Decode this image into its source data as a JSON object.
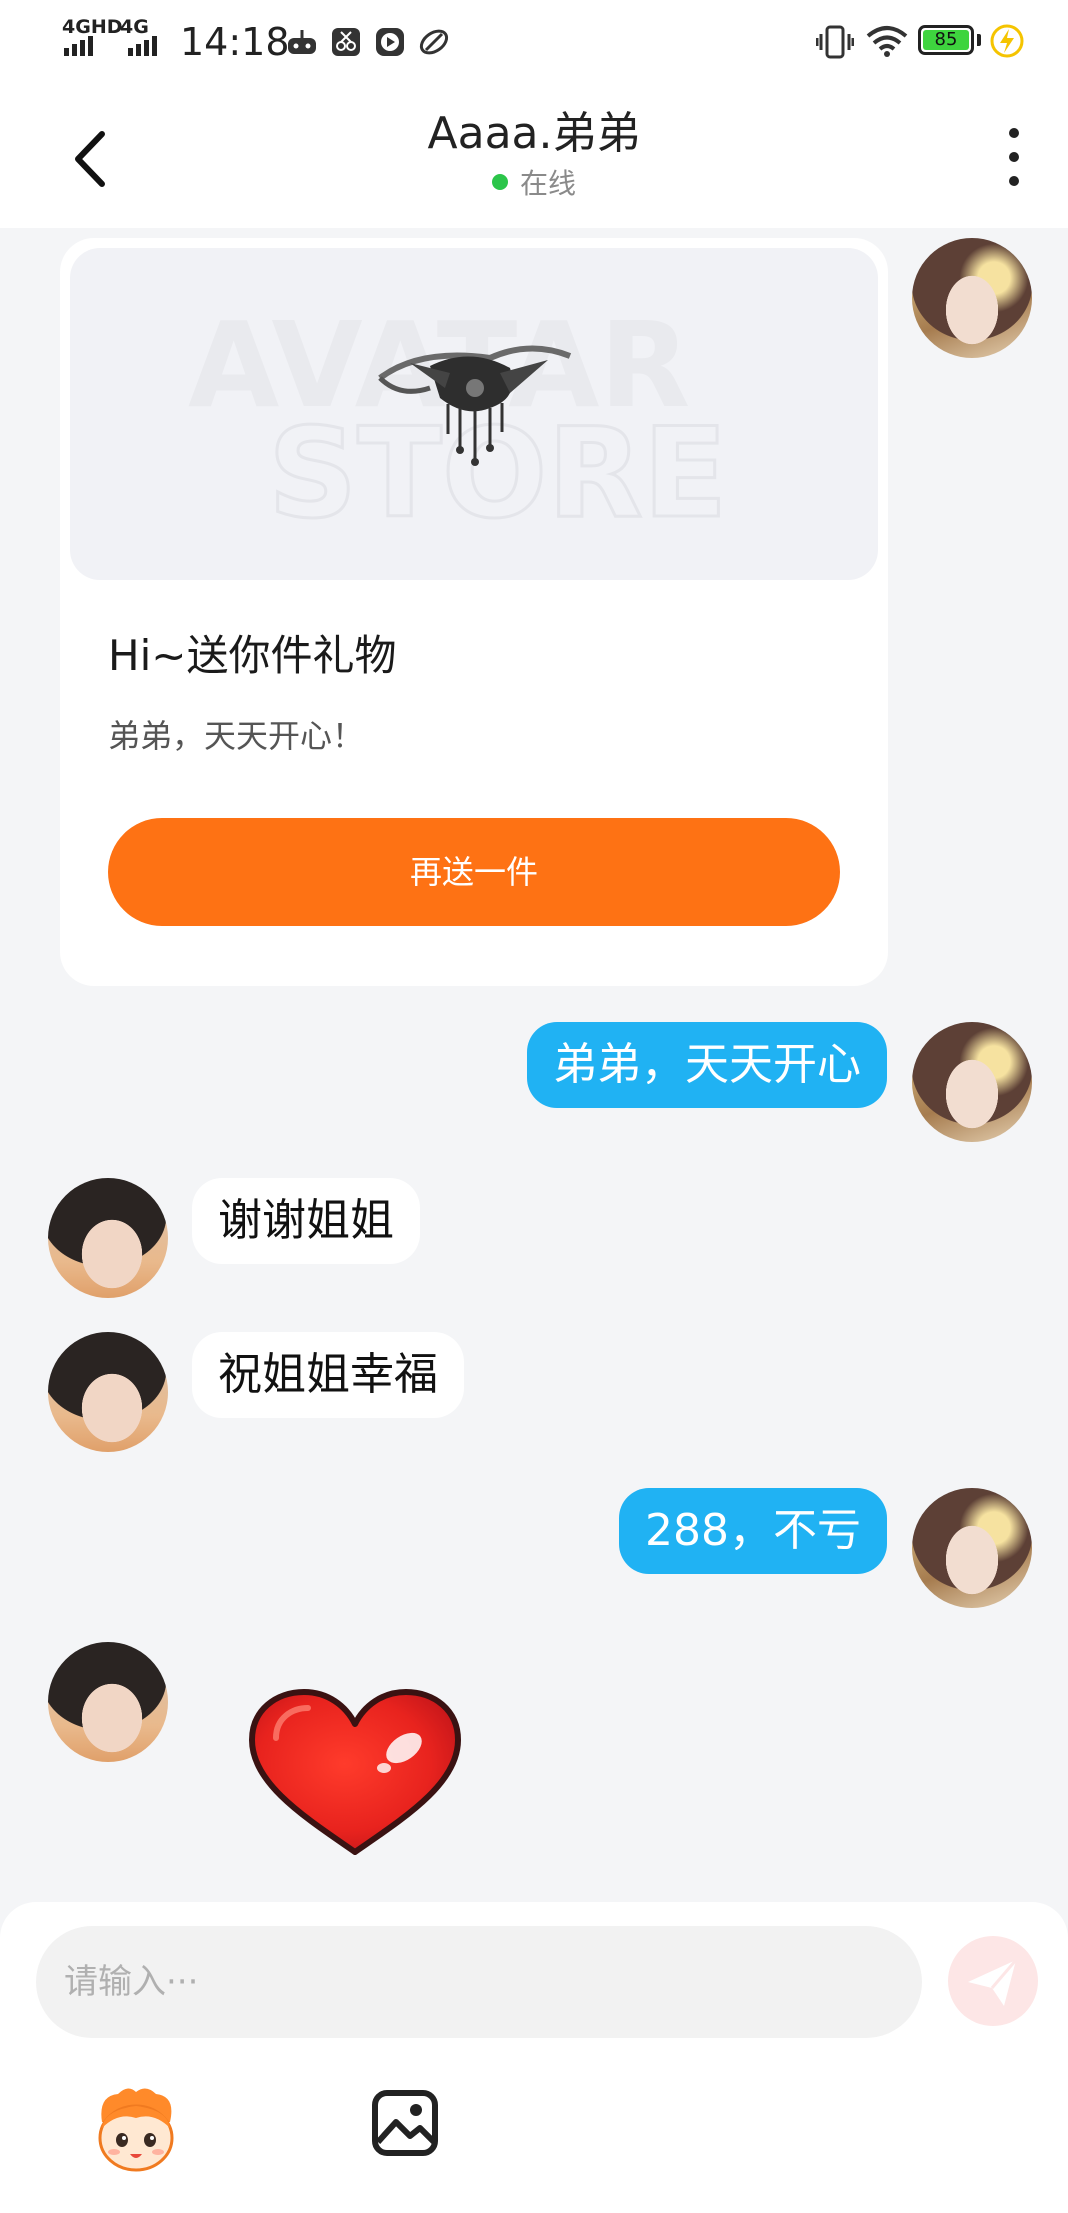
{
  "status_bar": {
    "signal1": "4GHD",
    "signal2": "4G",
    "time": "14:18",
    "battery": "85"
  },
  "header": {
    "title": "Aaaa.弟弟",
    "status": "在线"
  },
  "gift": {
    "title": "Hi~送你件礼物",
    "subtitle": "弟弟，天天开心！",
    "button": "再送一件",
    "watermark_line1": "AVATAR",
    "watermark_line2": "STORE"
  },
  "messages": [
    {
      "side": "right",
      "text": "弟弟，天天开心"
    },
    {
      "side": "left",
      "text": "谢谢姐姐"
    },
    {
      "side": "left",
      "text": "祝姐姐幸福"
    },
    {
      "side": "right",
      "text": "288，不亏"
    },
    {
      "side": "left",
      "sticker": "heart-sticker"
    }
  ],
  "input": {
    "placeholder": "请输入···"
  },
  "icons": {
    "back": "back-arrow-icon",
    "more": "more-vertical-icon",
    "send": "send-icon",
    "emoji": "emoji-mascot-icon",
    "image": "image-icon"
  },
  "colors": {
    "accent_orange": "#fe7214",
    "outgoing_bubble": "#20b2f3",
    "online_dot": "#2bc54a",
    "background": "#f4f5f7"
  }
}
